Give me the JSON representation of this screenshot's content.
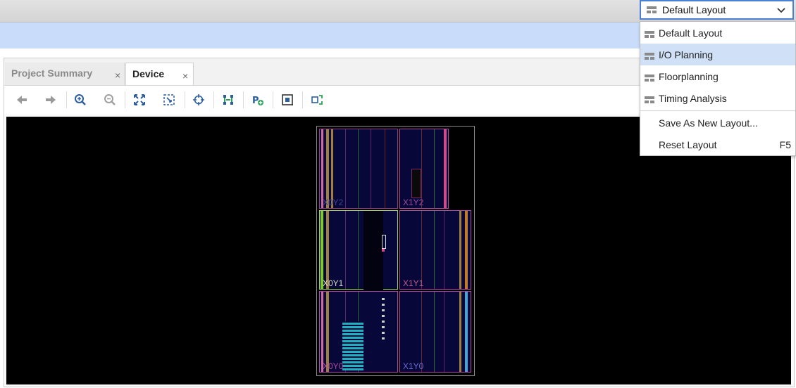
{
  "layout_selector": {
    "value": "Default Layout"
  },
  "layout_menu": {
    "items": [
      {
        "label": "Default Layout",
        "icon": "layout-icon"
      },
      {
        "label": "I/O Planning",
        "icon": "layout-icon",
        "highlighted": true
      },
      {
        "label": "Floorplanning",
        "icon": "layout-icon"
      },
      {
        "label": "Timing Analysis",
        "icon": "layout-icon"
      }
    ],
    "save_as": "Save As New Layout...",
    "reset": "Reset Layout",
    "reset_shortcut": "F5"
  },
  "tabs": [
    {
      "label": "Project Summary",
      "active": false,
      "close": "×"
    },
    {
      "label": "Device",
      "active": true,
      "close": "×"
    }
  ],
  "toolbar": [
    "back-icon",
    "forward-icon",
    "zoom-in-icon",
    "zoom-out-icon",
    "zoom-fit-icon",
    "zoom-selection-icon",
    "crosshair-icon",
    "route-icon",
    "add-pblock-icon",
    "site-view-icon",
    "autofit-selection-icon"
  ],
  "device": {
    "regions": [
      "X0Y2",
      "X1Y2",
      "X0Y1",
      "X1Y1",
      "X0Y0",
      "X1Y0"
    ]
  },
  "colors": {
    "accent": "#4a7fd4",
    "highlight": "#cfe0f7",
    "canvas": "#000000",
    "region_fill": "#07073a"
  }
}
